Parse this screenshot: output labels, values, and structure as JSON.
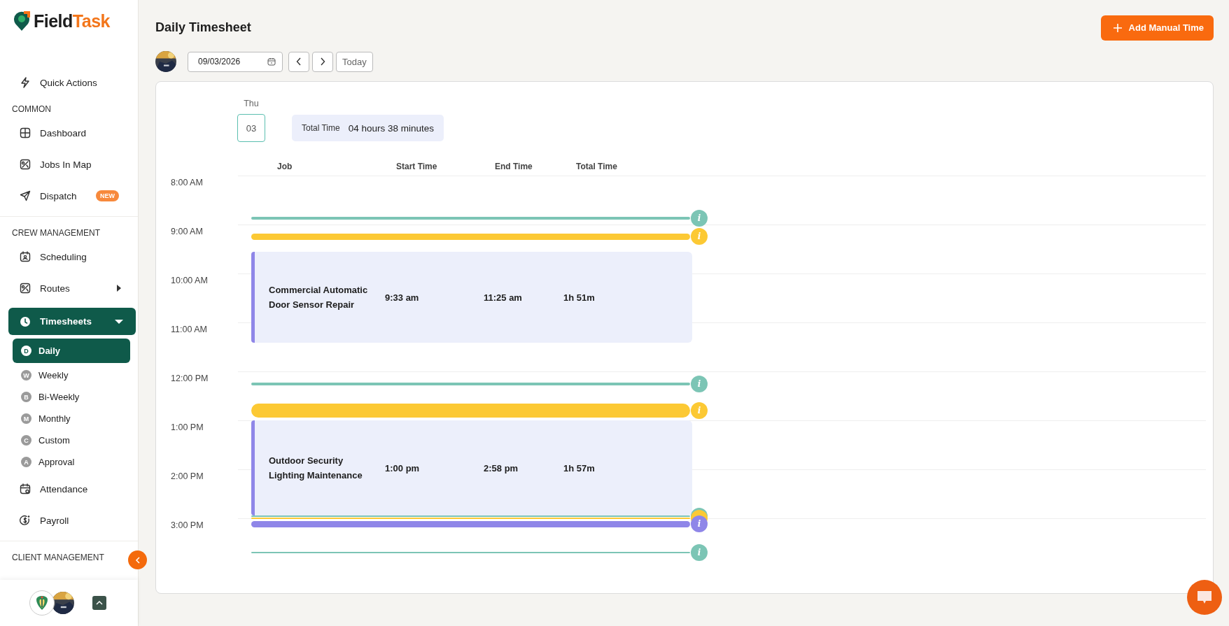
{
  "brand": {
    "first": "Field",
    "second": "Task"
  },
  "sidebar": {
    "top_items": [
      {
        "label": "Quick Actions"
      }
    ],
    "sections": [
      {
        "title": "COMMON",
        "items": [
          {
            "label": "Dashboard",
            "selected": false
          },
          {
            "label": "Jobs In Map",
            "selected": false
          },
          {
            "label": "Dispatch",
            "badge": "NEW",
            "selected": false
          }
        ]
      },
      {
        "title": "CREW MANAGEMENT",
        "items": [
          {
            "label": "Scheduling",
            "selected": false
          },
          {
            "label": "Routes",
            "expanded": false,
            "selected": false
          },
          {
            "label": "Timesheets",
            "expanded": true,
            "selected": true,
            "children": [
              {
                "letter": "D",
                "label": "Daily",
                "selected": true
              },
              {
                "letter": "W",
                "label": "Weekly",
                "selected": false
              },
              {
                "letter": "B",
                "label": "Bi-Weekly",
                "selected": false
              },
              {
                "letter": "M",
                "label": "Monthly",
                "selected": false
              },
              {
                "letter": "C",
                "label": "Custom",
                "selected": false
              },
              {
                "letter": "A",
                "label": "Approval",
                "selected": false
              }
            ]
          },
          {
            "label": "Attendance",
            "selected": false
          },
          {
            "label": "Payroll",
            "selected": false
          }
        ]
      },
      {
        "title": "CLIENT MANAGEMENT"
      }
    ]
  },
  "page": {
    "title": "Daily Timesheet",
    "add_button": "Add Manual Time",
    "date": "09/03/2026",
    "today_button": "Today"
  },
  "day": {
    "weekday": "Thu",
    "day": "03",
    "total_label": "Total Time",
    "total_value": "04 hours 38 minutes"
  },
  "columns": [
    "Job",
    "Start Time",
    "End Time",
    "Total Time"
  ],
  "hours": [
    "8:00 AM",
    "9:00 AM",
    "10:00 AM",
    "11:00 AM",
    "12:00 PM",
    "1:00 PM",
    "2:00 PM",
    "3:00 PM"
  ],
  "entries": [
    {
      "kind": "thin",
      "color": "#7cc5b5",
      "info": "i"
    },
    {
      "kind": "medium",
      "color": "#fcc934",
      "info": "i"
    },
    {
      "kind": "block",
      "job": "Commercial Automatic Door Sensor Repair",
      "start": "9:33 am",
      "end": "11:25 am",
      "total": "1h 51m"
    },
    {
      "kind": "thin",
      "color": "#7cc5b5",
      "info": "i"
    },
    {
      "kind": "thick",
      "color": "#fcc934",
      "info": "i"
    },
    {
      "kind": "block",
      "job": "Outdoor Security Lighting Maintenance",
      "start": "1:00 pm",
      "end": "2:58 pm",
      "total": "1h 57m"
    },
    {
      "kind": "hairline",
      "color": "#7cc5b5"
    },
    {
      "kind": "hairline",
      "color": "#fcc934"
    },
    {
      "kind": "medium",
      "color": "#8f86e8",
      "info": "i"
    },
    {
      "kind": "hairline",
      "color": "#7cc5b5",
      "info": "i"
    }
  ]
}
